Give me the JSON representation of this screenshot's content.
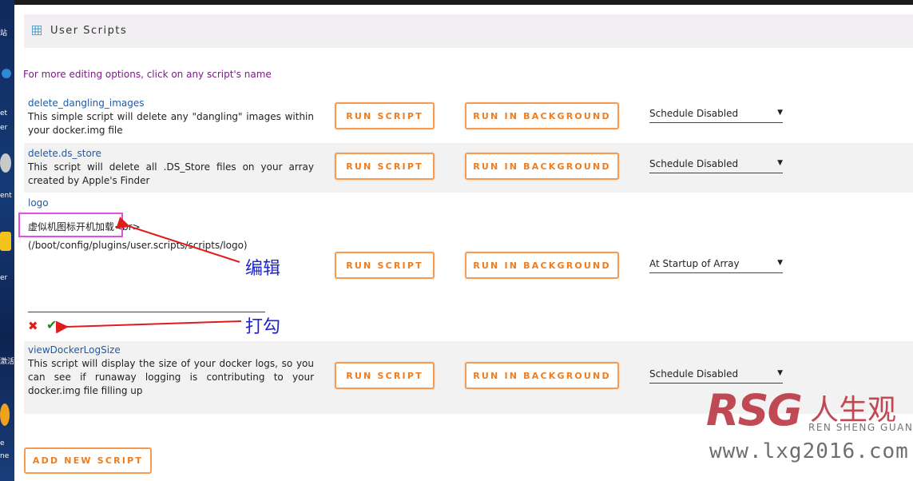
{
  "page": {
    "title": "User Scripts",
    "hint": "For more editing options, click on any script's name",
    "add_button": "ADD NEW SCRIPT"
  },
  "buttons": {
    "run": "RUN SCRIPT",
    "background": "RUN IN BACKGROUND"
  },
  "scripts": [
    {
      "name": "delete_dangling_images",
      "description": "This simple script will delete any \"dangling\" images within your docker.img file",
      "schedule": "Schedule Disabled"
    },
    {
      "name": "delete.ds_store",
      "description": "This script will delete all .DS_Store files on your array created by Apple's Finder",
      "schedule": "Schedule Disabled"
    },
    {
      "name": "logo",
      "description_edit": "虚似机图标开机加载<br>",
      "path": "(/boot/config/plugins/user.scripts/scripts/logo)",
      "schedule": "At Startup of Array"
    },
    {
      "name": "viewDockerLogSize",
      "description": "This script will display the size of your docker logs, so you can see if runaway logging is contributing to your docker.img file filling up",
      "schedule": "Schedule Disabled"
    }
  ],
  "annotations": {
    "edit": "编辑",
    "check": "打勾"
  },
  "desktop_fragments": [
    "站",
    "et",
    "er",
    "ent",
    "er",
    "激活",
    "e",
    "ne"
  ],
  "watermark": {
    "brand": "RSG",
    "cn": "人生观",
    "pinyin": "REN SHENG GUAN",
    "url": "www.lxg2016.com"
  },
  "colors": {
    "accent_orange": "#f07c1e",
    "link_blue": "#1f5aa6",
    "hint_purple": "#7a1d82",
    "highlight_magenta": "#e24de6",
    "arrow_red": "#e01d1d",
    "annotation_blue": "#1f25c8"
  },
  "icons": {
    "title": "grid-icon",
    "cancel": "x-icon",
    "confirm": "check-icon",
    "dropdown": "triangle-down"
  }
}
